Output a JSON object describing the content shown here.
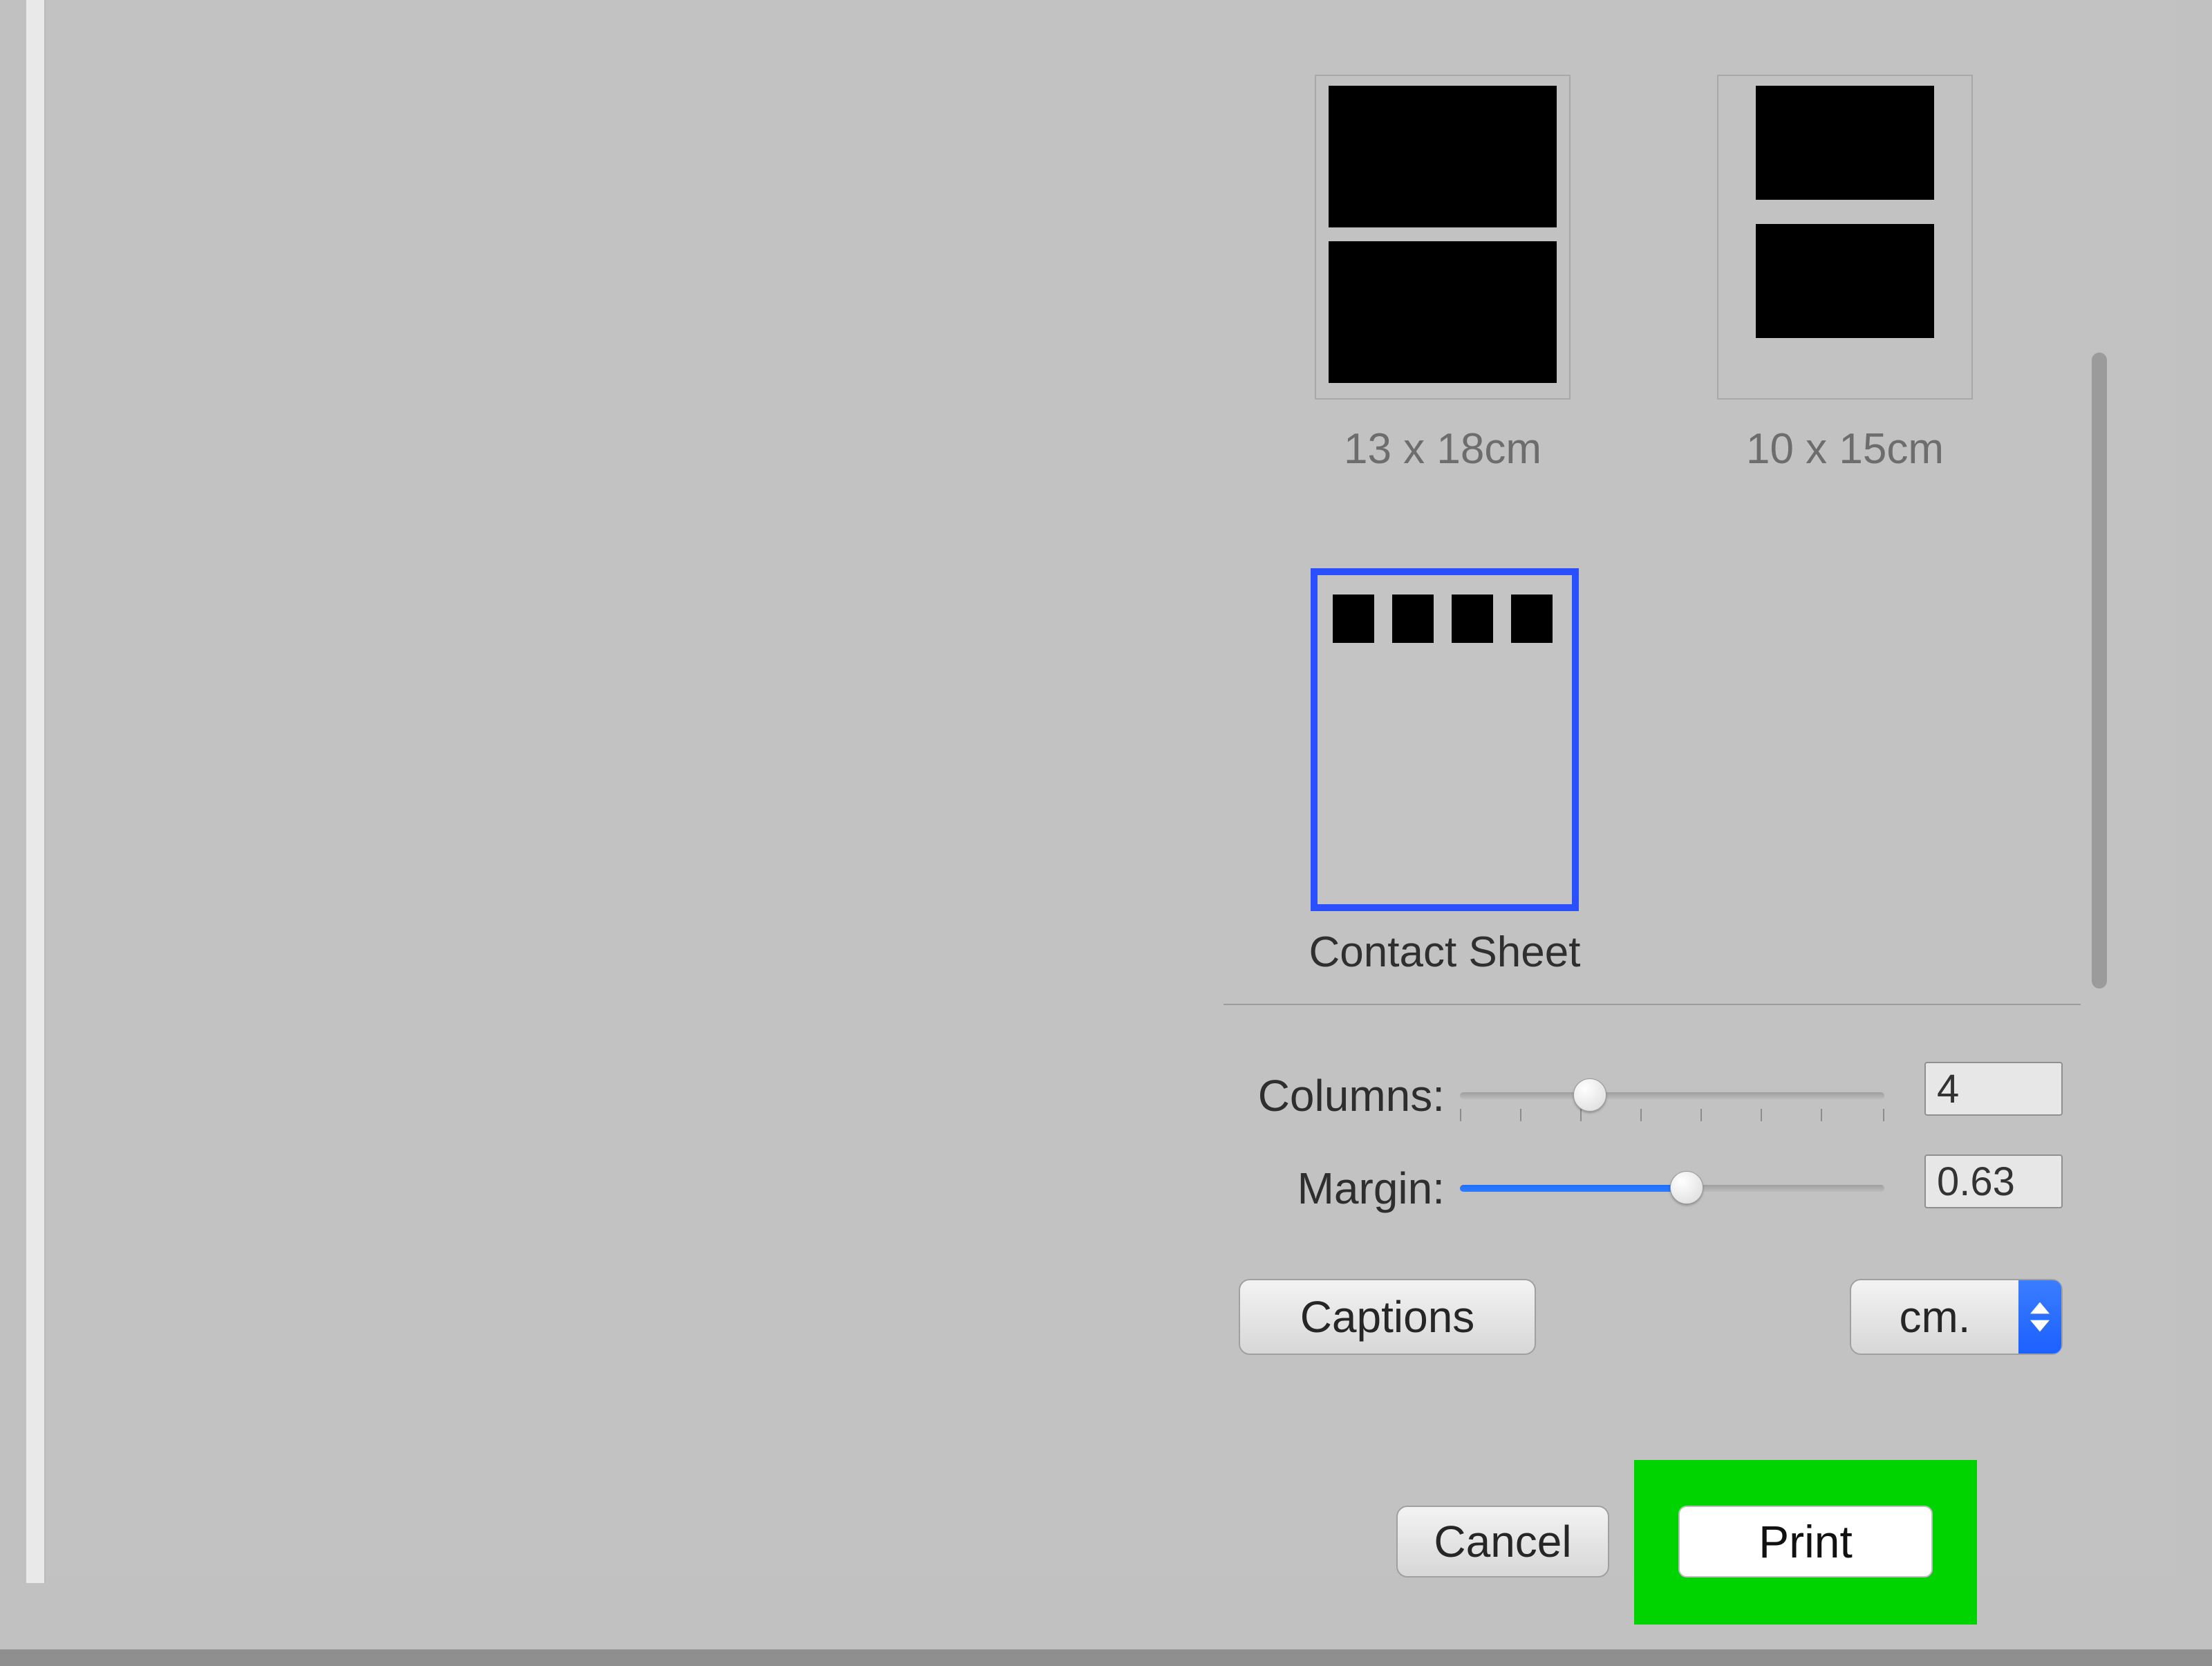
{
  "layout_options": [
    {
      "id": "13x18",
      "label": "13 x 18cm",
      "selected": false
    },
    {
      "id": "10x15",
      "label": "10 x 15cm",
      "selected": false
    },
    {
      "id": "contact",
      "label": "Contact Sheet",
      "selected": true
    }
  ],
  "controls": {
    "columns": {
      "label": "Columns:",
      "value": "4",
      "min": 1,
      "max": 10,
      "position_pct": 30
    },
    "margin": {
      "label": "Margin:",
      "value": "0.63",
      "min": 0,
      "max": 1.2,
      "position_pct": 52
    }
  },
  "captions_button": "Captions",
  "unit_popup": {
    "value": "cm."
  },
  "buttons": {
    "cancel": "Cancel",
    "print": "Print"
  },
  "highlight_color": "#00d400"
}
